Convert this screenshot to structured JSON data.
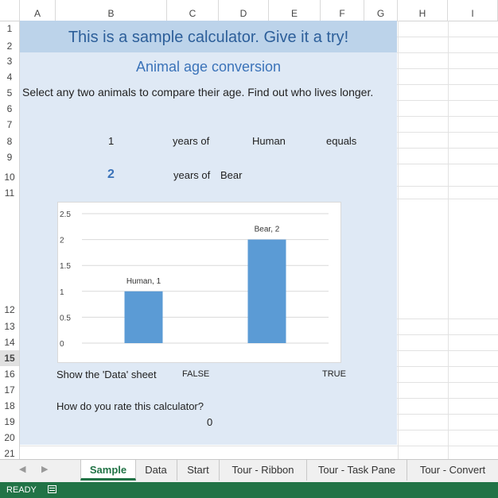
{
  "columns": [
    "A",
    "B",
    "C",
    "D",
    "E",
    "F",
    "G",
    "H",
    "I"
  ],
  "rows": [
    "1",
    "2",
    "3",
    "4",
    "5",
    "6",
    "7",
    "8",
    "9",
    "10",
    "11",
    "12",
    "13",
    "14",
    "15",
    "16",
    "17",
    "18",
    "19",
    "20",
    "21"
  ],
  "sheet": {
    "title": "This is a sample calculator. Give it a try!",
    "subtitle": "Animal age conversion",
    "description": "Select any two animals to compare their age. Find out who lives longer.",
    "row8": {
      "value": "1",
      "years_of": "years of",
      "animal": "Human",
      "equals": "equals"
    },
    "row10": {
      "value": "2",
      "years_of": "years of",
      "animal": "Bear"
    },
    "show_data_label": "Show the 'Data' sheet",
    "false_label": "FALSE",
    "true_label": "TRUE",
    "rate_label": "How do you rate this calculator?",
    "rate_value": "0"
  },
  "chart_data": {
    "type": "bar",
    "categories": [
      "Human",
      "Bear"
    ],
    "values": [
      1,
      2
    ],
    "data_labels": [
      "Human, 1",
      "Bear, 2"
    ],
    "ylim": [
      0,
      2.5
    ],
    "yticks": [
      "0",
      "0.5",
      "1",
      "1.5",
      "2",
      "2.5"
    ],
    "grid": true,
    "bar_color": "#5b9bd5"
  },
  "tabs": [
    "Sample",
    "Data",
    "Start",
    "Tour - Ribbon",
    "Tour - Task Pane",
    "Tour - Convert"
  ],
  "status": {
    "text": "READY"
  },
  "colors": {
    "accent": "#217346",
    "panel": "#dfe9f5",
    "title_band": "#bcd3ea"
  }
}
